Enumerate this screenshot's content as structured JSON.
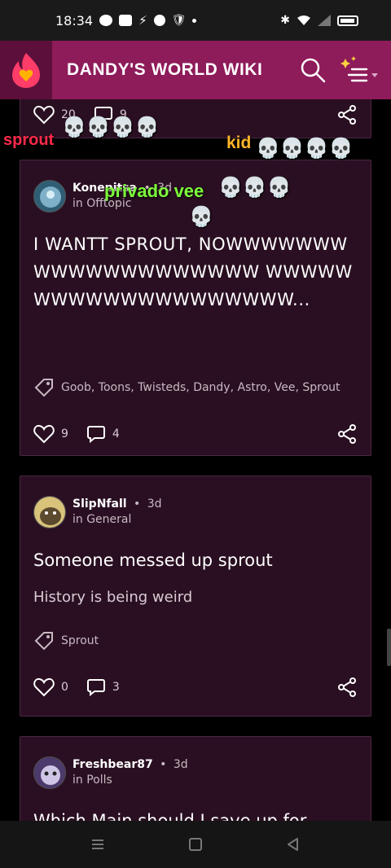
{
  "status_bar": {
    "time": "18:34"
  },
  "app": {
    "title": "DANDY'S WORLD WIKI"
  },
  "posts": [
    {
      "likes": "20",
      "comments": "9"
    },
    {
      "author": "Konepitsa",
      "time": "3d",
      "category": "in Offtopic",
      "title": "I WANTT SPROUT, NOWWWWWWWWWWWWWWWWWWWW WWWWWWWWWWWWWWWWWWWW...",
      "tags": "Goob, Toons, Twisteds, Dandy, Astro, Vee, Sprout",
      "likes": "9",
      "comments": "4"
    },
    {
      "author": "SlipNfall",
      "time": "3d",
      "category": "in General",
      "title": "Someone messed up sprout",
      "body": "History is being weird",
      "tags": "Sprout",
      "likes": "0",
      "comments": "3"
    },
    {
      "author": "Freshbear87",
      "time": "3d",
      "category": "in Polls",
      "title": "Which Main should I save up for"
    }
  ],
  "overlays": {
    "sprout": "sprout",
    "kid": "kid",
    "privado_vee": "privado vee",
    "skull_glyph": "💀"
  },
  "colors": {
    "app_bar": "#8e1b5a",
    "card_bg": "#2a0f22",
    "logo_flame": "#ff3d68",
    "heart": "#ffb300"
  }
}
